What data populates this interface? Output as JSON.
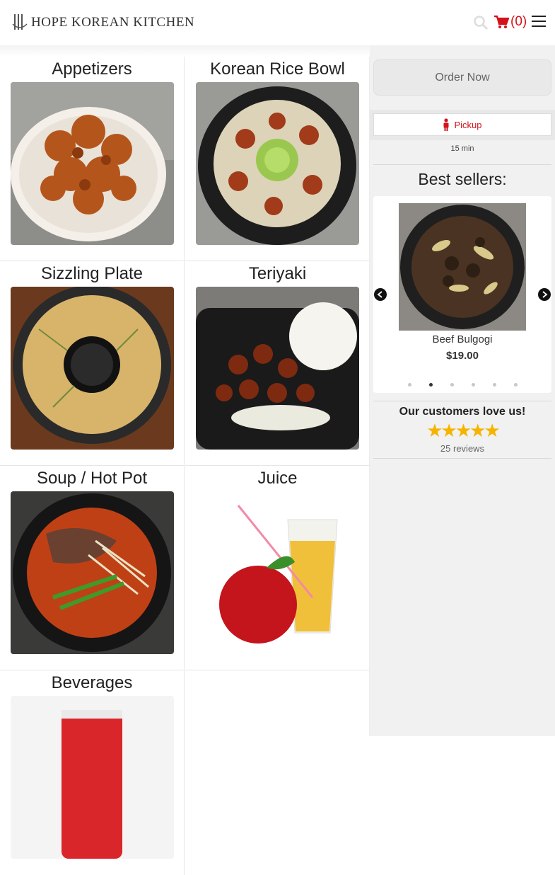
{
  "header": {
    "logo_text": "HOPE KOREAN KITCHEN",
    "cart_count": "(0)",
    "icons": [
      "chopsticks-logo-icon",
      "search-icon",
      "cart-icon",
      "menu-icon"
    ],
    "brand_color": "#d3131b"
  },
  "categories": [
    {
      "label": "Appetizers"
    },
    {
      "label": "Korean Rice Bowl"
    },
    {
      "label": "Sizzling Plate"
    },
    {
      "label": "Teriyaki"
    },
    {
      "label": "Soup / Hot Pot"
    },
    {
      "label": "Juice"
    },
    {
      "label": "Beverages"
    }
  ],
  "sidebar": {
    "order_button": "Order Now",
    "pickup_label": "Pickup",
    "pickup_time": "15 min",
    "best_sellers_title": "Best sellers:",
    "carousel": {
      "item_name": "Beef Bulgogi",
      "item_price": "$19.00",
      "prev_label": "Previous",
      "next_label": "Next",
      "dot_count": 6,
      "active_dot": 2
    },
    "reviews_title": "Our customers love us!",
    "stars": "★★★★★",
    "reviews_count": "25 reviews"
  }
}
